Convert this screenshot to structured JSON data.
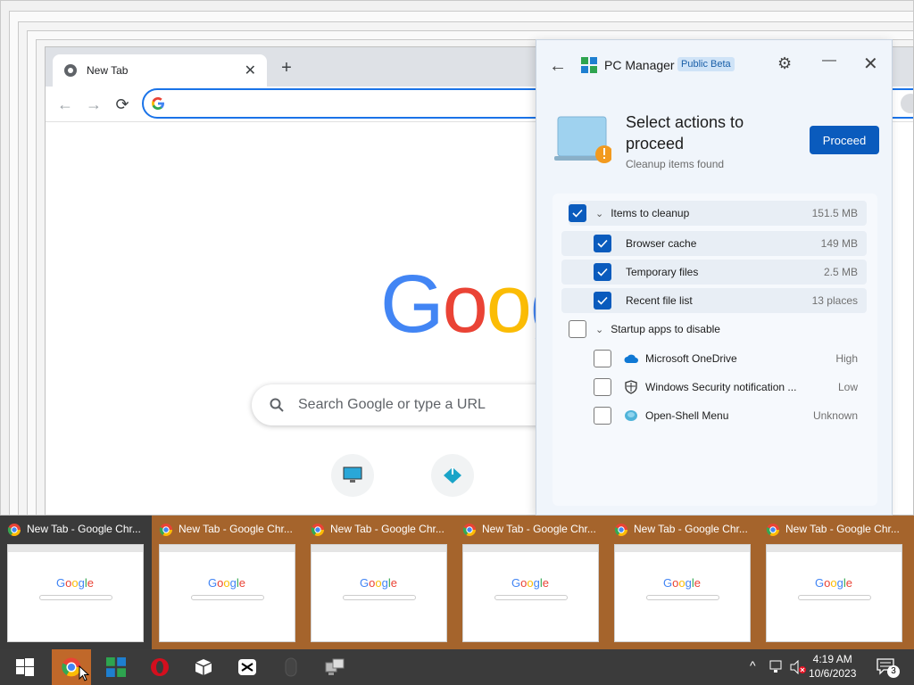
{
  "chrome": {
    "tab_title": "New Tab",
    "tab_close": "✕",
    "new_tab": "+",
    "back": "←",
    "forward": "→",
    "reload": "⟳",
    "google_letters": [
      "G",
      "o",
      "o",
      "g",
      "l",
      "e"
    ],
    "search_placeholder": "Search Google or type a URL"
  },
  "pc_manager": {
    "back": "←",
    "title": "PC Manager",
    "badge": "Public Beta",
    "heading": "Select actions to proceed",
    "subheading": "Cleanup items found",
    "proceed_label": "Proceed",
    "groups": [
      {
        "label": "Items to cleanup",
        "value": "151.5 MB",
        "checked": true,
        "items": [
          {
            "label": "Browser cache",
            "value": "149 MB",
            "checked": true
          },
          {
            "label": "Temporary files",
            "value": "2.5 MB",
            "checked": true
          },
          {
            "label": "Recent file list",
            "value": "13 places",
            "checked": true
          }
        ]
      },
      {
        "label": "Startup apps to disable",
        "value": "",
        "checked": false,
        "items": [
          {
            "label": "Microsoft OneDrive",
            "value": "High",
            "checked": false,
            "icon": "onedrive-icon"
          },
          {
            "label": "Windows Security notification ...",
            "value": "Low",
            "checked": false,
            "icon": "shield-icon"
          },
          {
            "label": "Open-Shell Menu",
            "value": "Unknown",
            "checked": false,
            "icon": "openshell-icon"
          }
        ]
      }
    ]
  },
  "thumbnails": [
    {
      "title": "New Tab - Google Chr..."
    },
    {
      "title": "New Tab - Google Chr..."
    },
    {
      "title": "New Tab - Google Chr..."
    },
    {
      "title": "New Tab - Google Chr..."
    },
    {
      "title": "New Tab - Google Chr..."
    },
    {
      "title": "New Tab - Google Chr..."
    }
  ],
  "taskbar": {
    "time": "4:19 AM",
    "date": "10/6/2023",
    "notification_count": "3",
    "tray_chevron": "^"
  },
  "colors": {
    "accent": "#0a5bbd",
    "taskbar": "#3b3b3b",
    "thumb_strip": "#a5642c"
  }
}
